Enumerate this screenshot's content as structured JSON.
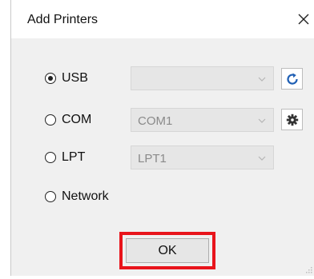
{
  "window": {
    "title": "Add Printers",
    "close_icon": "close-icon"
  },
  "connection": {
    "selected": "USB",
    "options": [
      {
        "label": "USB",
        "checked": true,
        "combo_value": "",
        "action_icon": "refresh-icon"
      },
      {
        "label": "COM",
        "checked": false,
        "combo_value": "COM1",
        "action_icon": "gear-icon"
      },
      {
        "label": "LPT",
        "checked": false,
        "combo_value": "LPT1"
      },
      {
        "label": "Network",
        "checked": false
      }
    ]
  },
  "buttons": {
    "ok_label": "OK"
  },
  "colors": {
    "highlight": "#e8141b",
    "refresh_icon": "#1f5fb4"
  }
}
